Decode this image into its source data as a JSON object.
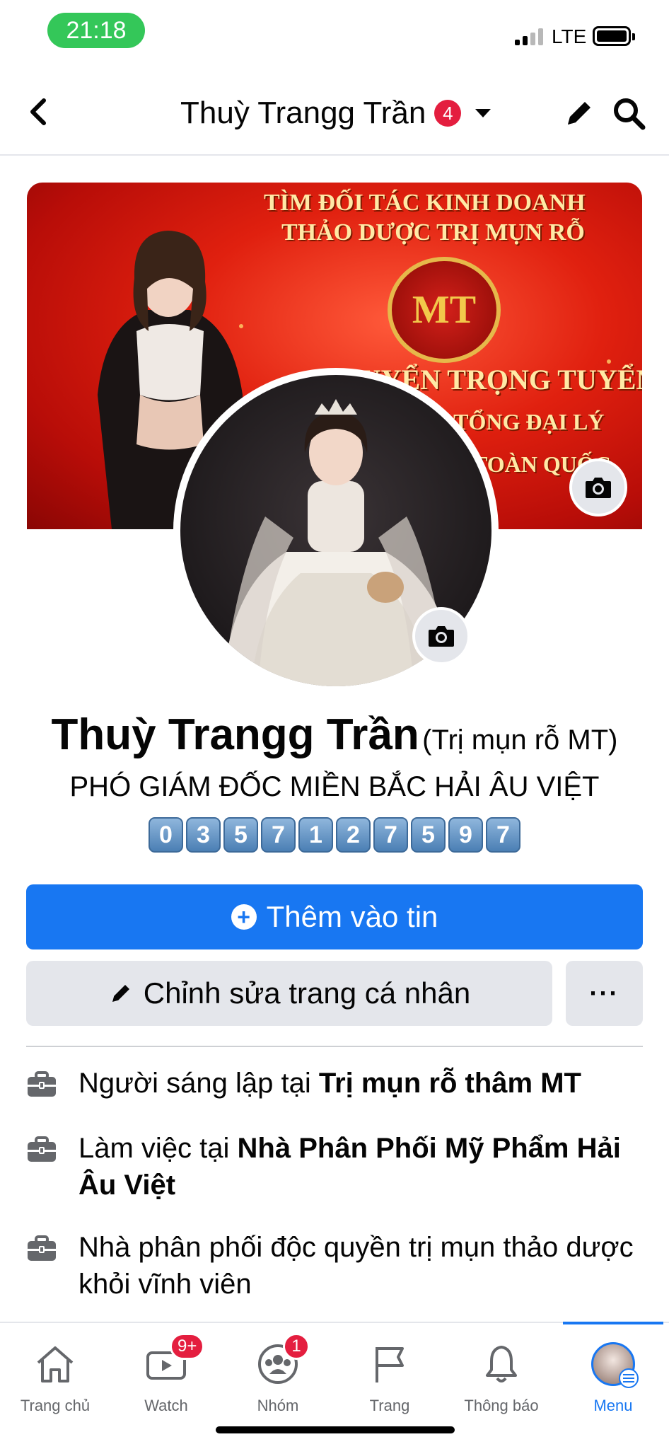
{
  "status_bar": {
    "time": "21:18",
    "network": "LTE"
  },
  "header": {
    "title": "Thuỳ Trangg Trần",
    "badge": "4"
  },
  "cover": {
    "line1": "TÌM ĐỐI TÁC KINH DOANH",
    "line2": "THẢO DƯỢC TRỊ MỤN RỖ",
    "logo": "MT",
    "line3": "TUYỂN TRỌNG TUYỂN",
    "line4": "I-TỔNG ĐẠI LÝ",
    "line5": "TOÀN QUỐC"
  },
  "profile": {
    "name": "Thuỳ Trangg Trần",
    "alt_name": "(Trị mụn rỗ MT)",
    "subtitle": "PHÓ GIÁM ĐỐC MIỀN BẮC HẢI ÂU VIỆT",
    "phone_digits": [
      "0",
      "3",
      "5",
      "7",
      "1",
      "2",
      "7",
      "5",
      "9",
      "7"
    ]
  },
  "buttons": {
    "add_story": "Thêm vào tin",
    "edit_profile": "Chỉnh sửa trang cá nhân",
    "more": "···"
  },
  "info": [
    {
      "prefix": "Người sáng lập tại ",
      "bold": "Trị mụn rỗ thâm MT",
      "icon": "briefcase-icon"
    },
    {
      "prefix": "Làm việc tại ",
      "bold": "Nhà Phân Phối Mỹ Phẩm Hải Âu Việt",
      "icon": "briefcase-icon"
    },
    {
      "prefix": "Nhà phân phối độc quyền trị mụn thảo dược khỏi vĩnh viên",
      "bold": "",
      "icon": "briefcase-icon"
    }
  ],
  "bottom_nav": [
    {
      "label": "Trang chủ",
      "icon": "home-icon",
      "badge": ""
    },
    {
      "label": "Watch",
      "icon": "watch-icon",
      "badge": "9+"
    },
    {
      "label": "Nhóm",
      "icon": "groups-icon",
      "badge": "1"
    },
    {
      "label": "Trang",
      "icon": "flag-icon",
      "badge": ""
    },
    {
      "label": "Thông báo",
      "icon": "bell-icon",
      "badge": ""
    },
    {
      "label": "Menu",
      "icon": "menu-avatar-icon",
      "badge": "",
      "active": true
    }
  ],
  "colors": {
    "accent": "#1877f2",
    "badge": "#e41e3f",
    "button_gray": "#e4e6eb"
  }
}
